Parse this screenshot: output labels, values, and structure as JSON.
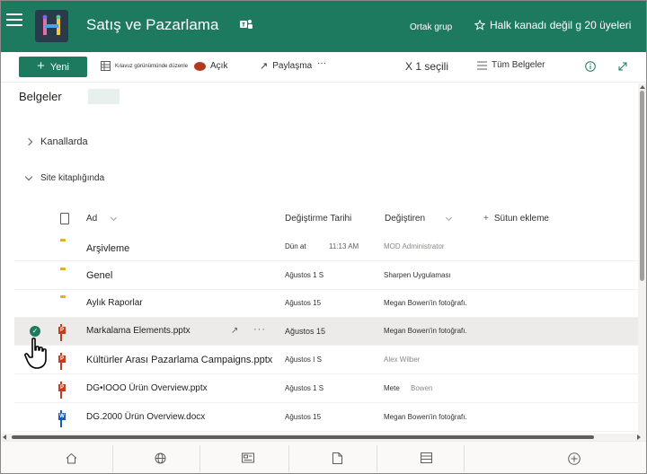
{
  "header": {
    "site_title": "Satış ve Pazarlama",
    "group_label": "Ortak grup",
    "follow_label": "Halk kanadı değil g 20 üyeleri",
    "colors": {
      "header_bg": "#1e7a5e",
      "accent": "#1e7a5e"
    }
  },
  "commandbar": {
    "new_label": "Yeni",
    "grid_edit_label": "Kılavuz görünümünde düzenle",
    "open_label": "Açık",
    "share_label": "Paylaşma",
    "more_label": "···",
    "selected_label": "X 1 seçili",
    "view_label": "Tüm Belgeler"
  },
  "page": {
    "title": "Belgeler",
    "sections": [
      {
        "label": "Kanallarda",
        "expanded": false
      },
      {
        "label": "Site kitaplığında",
        "expanded": true
      }
    ]
  },
  "columns": {
    "name": "Ad",
    "modified": "Değiştirme Tarihi",
    "modified_by": "Değiştiren",
    "add_column": "Sütun ekleme"
  },
  "rows": [
    {
      "type": "folder",
      "name": "Arşivleme",
      "modified": "Dün at",
      "modified_time": "11:13 AM",
      "modified_by": "MOD Administrator",
      "by_grey": true
    },
    {
      "type": "folder",
      "name": "Genel",
      "modified": "Ağustos 1 S",
      "modified_by": "Sharpen Uygulaması"
    },
    {
      "type": "folder",
      "name": "Aylık Raporlar",
      "modified": "Ağustos 15",
      "modified_by": "Megan Bowen'in fotoğrafı."
    },
    {
      "type": "ppt",
      "name": "Markalama Elements.pptx",
      "modified": "Ağustos 15",
      "modified_by": "Megan Bowen'in fotoğrafı.",
      "selected": true
    },
    {
      "type": "ppt",
      "name": "Kültürler Arası Pazarlama Campaigns.pptx",
      "modified": "Ağustos I S",
      "modified_by": "Alex Wilber",
      "by_grey": true
    },
    {
      "type": "ppt",
      "name": "DG•IOOO Ürün Overview.pptx",
      "modified": "Ağustos 1 S",
      "modified_by": "Mete",
      "modified_by2": "Bowen"
    },
    {
      "type": "doc",
      "name": "DG.2000 Ürün Overview.docx",
      "modified": "Ağustos 15",
      "modified_by": "Megan Bowen'in fotoğrafı."
    }
  ],
  "icons": {
    "menu": "hamburger-icon",
    "teams": "teams-icon",
    "follow": "star-icon",
    "info": "info-icon",
    "expand": "expand-icon",
    "bottom_nav": [
      "home-icon",
      "globe-icon",
      "news-icon",
      "file-icon",
      "list-icon",
      "add-icon"
    ]
  }
}
